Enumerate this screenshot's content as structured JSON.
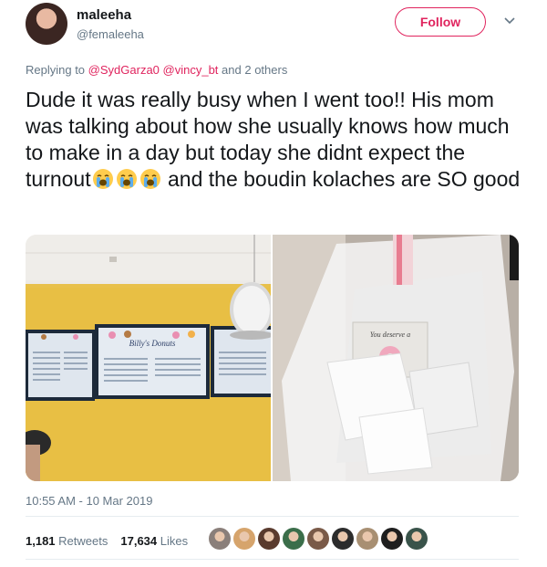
{
  "user": {
    "name": "maleeha",
    "handle": "@femaleeha"
  },
  "follow_label": "Follow",
  "reply": {
    "prefix": "Replying to",
    "mentions": [
      "@SydGarza0",
      "@vincy_bt"
    ],
    "suffix": "and 2 others"
  },
  "tweet": {
    "text_part1": "Dude it was really busy when I went too!! His mom was talking about how she usually knows how much to make in a day but today she didnt expect the turnout",
    "text_part2": " and the boudin kolaches are SO good",
    "emoji": [
      "loudly-crying-face",
      "loudly-crying-face",
      "loudly-crying-face"
    ]
  },
  "media": {
    "left_menu_title": "Billy's Donuts",
    "right_sign_text": "You deserve a"
  },
  "timestamp": "10:55 AM - 10 Mar 2019",
  "stats": {
    "retweets_count": "1,181",
    "retweets_label": "Retweets",
    "likes_count": "17,634",
    "likes_label": "Likes"
  },
  "likers": [
    "#8a7f7a",
    "#d6a46c",
    "#5a3b2e",
    "#3b6e4a",
    "#7a5a48",
    "#2c2c2c",
    "#a88f72",
    "#1e1e1e",
    "#39534a"
  ],
  "colors": {
    "accent": "#e0245e",
    "muted": "#657786",
    "text": "#14171a"
  }
}
